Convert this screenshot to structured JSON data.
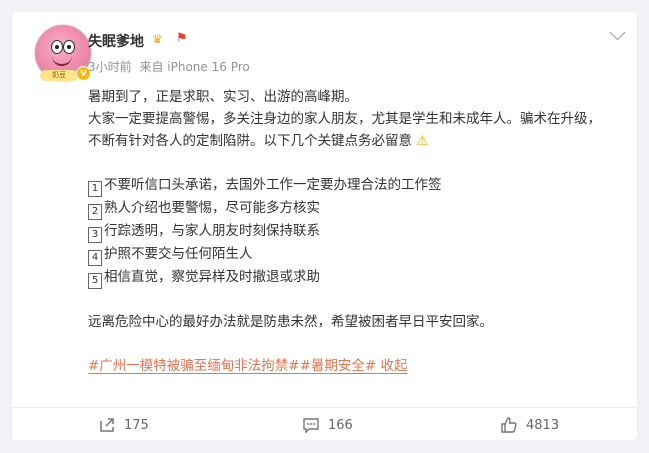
{
  "post": {
    "username": "失眠爹地",
    "time": "3小时前",
    "source": "来自 iPhone 16 Pro",
    "avatar_tag": "奶豆",
    "crown_icon": "crown-icon",
    "flag_icon": "flag-icon",
    "lines": [
      "暑期到了，正是求职、实习、出游的高峰期。",
      "大家一定要提高警惕，多关注身边的家人朋友，尤其是学生和未成年人。骗术在升级，不断有针对各人的定制陷阱。以下几个关键点务必留意"
    ],
    "warning_icon": "⚠",
    "tips": [
      {
        "num": "1",
        "text": "不要听信口头承诺，去国外工作一定要办理合法的工作签"
      },
      {
        "num": "2",
        "text": "熟人介绍也要警惕，尽可能多方核实"
      },
      {
        "num": "3",
        "text": "行踪透明，与家人朋友时刻保持联系"
      },
      {
        "num": "4",
        "text": "护照不要交与任何陌生人"
      },
      {
        "num": "5",
        "text": "相信直觉，察觉异样及时撤退或求助"
      }
    ],
    "closing": "远离危险中心的最好办法就是防患未然，希望被困者早日平安回家。",
    "hashtags": [
      "#广州一模特被骗至缅甸非法拘禁#",
      "#暑期安全#"
    ],
    "collapse_label": "收起"
  },
  "actions": {
    "repost_count": "175",
    "comment_count": "166",
    "like_count": "4813"
  },
  "colors": {
    "link": "#eb7350",
    "meta": "#939393",
    "verified": "#f9b60c"
  }
}
